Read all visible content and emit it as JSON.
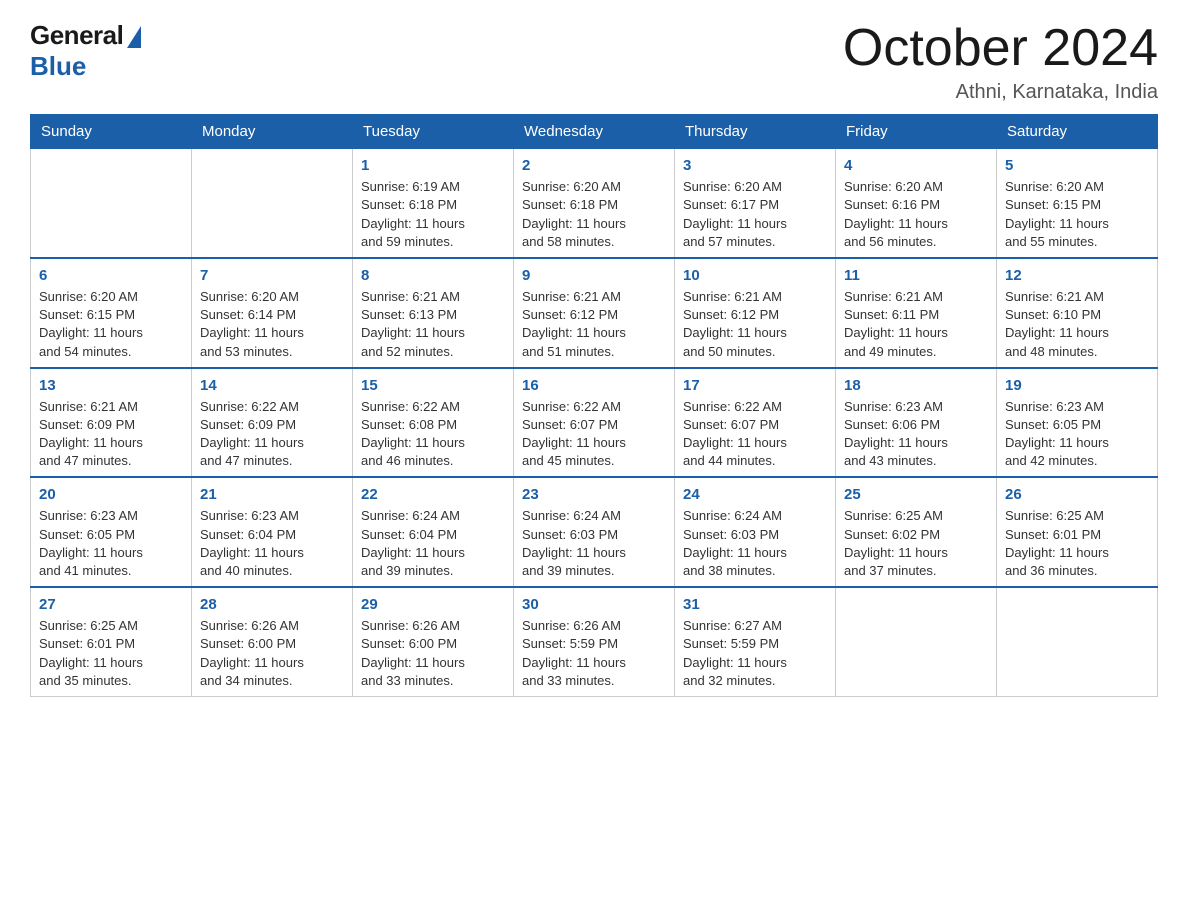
{
  "logo": {
    "general": "General",
    "blue": "Blue"
  },
  "title": "October 2024",
  "location": "Athni, Karnataka, India",
  "headers": [
    "Sunday",
    "Monday",
    "Tuesday",
    "Wednesday",
    "Thursday",
    "Friday",
    "Saturday"
  ],
  "weeks": [
    [
      {
        "day": "",
        "info": ""
      },
      {
        "day": "",
        "info": ""
      },
      {
        "day": "1",
        "info": "Sunrise: 6:19 AM\nSunset: 6:18 PM\nDaylight: 11 hours\nand 59 minutes."
      },
      {
        "day": "2",
        "info": "Sunrise: 6:20 AM\nSunset: 6:18 PM\nDaylight: 11 hours\nand 58 minutes."
      },
      {
        "day": "3",
        "info": "Sunrise: 6:20 AM\nSunset: 6:17 PM\nDaylight: 11 hours\nand 57 minutes."
      },
      {
        "day": "4",
        "info": "Sunrise: 6:20 AM\nSunset: 6:16 PM\nDaylight: 11 hours\nand 56 minutes."
      },
      {
        "day": "5",
        "info": "Sunrise: 6:20 AM\nSunset: 6:15 PM\nDaylight: 11 hours\nand 55 minutes."
      }
    ],
    [
      {
        "day": "6",
        "info": "Sunrise: 6:20 AM\nSunset: 6:15 PM\nDaylight: 11 hours\nand 54 minutes."
      },
      {
        "day": "7",
        "info": "Sunrise: 6:20 AM\nSunset: 6:14 PM\nDaylight: 11 hours\nand 53 minutes."
      },
      {
        "day": "8",
        "info": "Sunrise: 6:21 AM\nSunset: 6:13 PM\nDaylight: 11 hours\nand 52 minutes."
      },
      {
        "day": "9",
        "info": "Sunrise: 6:21 AM\nSunset: 6:12 PM\nDaylight: 11 hours\nand 51 minutes."
      },
      {
        "day": "10",
        "info": "Sunrise: 6:21 AM\nSunset: 6:12 PM\nDaylight: 11 hours\nand 50 minutes."
      },
      {
        "day": "11",
        "info": "Sunrise: 6:21 AM\nSunset: 6:11 PM\nDaylight: 11 hours\nand 49 minutes."
      },
      {
        "day": "12",
        "info": "Sunrise: 6:21 AM\nSunset: 6:10 PM\nDaylight: 11 hours\nand 48 minutes."
      }
    ],
    [
      {
        "day": "13",
        "info": "Sunrise: 6:21 AM\nSunset: 6:09 PM\nDaylight: 11 hours\nand 47 minutes."
      },
      {
        "day": "14",
        "info": "Sunrise: 6:22 AM\nSunset: 6:09 PM\nDaylight: 11 hours\nand 47 minutes."
      },
      {
        "day": "15",
        "info": "Sunrise: 6:22 AM\nSunset: 6:08 PM\nDaylight: 11 hours\nand 46 minutes."
      },
      {
        "day": "16",
        "info": "Sunrise: 6:22 AM\nSunset: 6:07 PM\nDaylight: 11 hours\nand 45 minutes."
      },
      {
        "day": "17",
        "info": "Sunrise: 6:22 AM\nSunset: 6:07 PM\nDaylight: 11 hours\nand 44 minutes."
      },
      {
        "day": "18",
        "info": "Sunrise: 6:23 AM\nSunset: 6:06 PM\nDaylight: 11 hours\nand 43 minutes."
      },
      {
        "day": "19",
        "info": "Sunrise: 6:23 AM\nSunset: 6:05 PM\nDaylight: 11 hours\nand 42 minutes."
      }
    ],
    [
      {
        "day": "20",
        "info": "Sunrise: 6:23 AM\nSunset: 6:05 PM\nDaylight: 11 hours\nand 41 minutes."
      },
      {
        "day": "21",
        "info": "Sunrise: 6:23 AM\nSunset: 6:04 PM\nDaylight: 11 hours\nand 40 minutes."
      },
      {
        "day": "22",
        "info": "Sunrise: 6:24 AM\nSunset: 6:04 PM\nDaylight: 11 hours\nand 39 minutes."
      },
      {
        "day": "23",
        "info": "Sunrise: 6:24 AM\nSunset: 6:03 PM\nDaylight: 11 hours\nand 39 minutes."
      },
      {
        "day": "24",
        "info": "Sunrise: 6:24 AM\nSunset: 6:03 PM\nDaylight: 11 hours\nand 38 minutes."
      },
      {
        "day": "25",
        "info": "Sunrise: 6:25 AM\nSunset: 6:02 PM\nDaylight: 11 hours\nand 37 minutes."
      },
      {
        "day": "26",
        "info": "Sunrise: 6:25 AM\nSunset: 6:01 PM\nDaylight: 11 hours\nand 36 minutes."
      }
    ],
    [
      {
        "day": "27",
        "info": "Sunrise: 6:25 AM\nSunset: 6:01 PM\nDaylight: 11 hours\nand 35 minutes."
      },
      {
        "day": "28",
        "info": "Sunrise: 6:26 AM\nSunset: 6:00 PM\nDaylight: 11 hours\nand 34 minutes."
      },
      {
        "day": "29",
        "info": "Sunrise: 6:26 AM\nSunset: 6:00 PM\nDaylight: 11 hours\nand 33 minutes."
      },
      {
        "day": "30",
        "info": "Sunrise: 6:26 AM\nSunset: 5:59 PM\nDaylight: 11 hours\nand 33 minutes."
      },
      {
        "day": "31",
        "info": "Sunrise: 6:27 AM\nSunset: 5:59 PM\nDaylight: 11 hours\nand 32 minutes."
      },
      {
        "day": "",
        "info": ""
      },
      {
        "day": "",
        "info": ""
      }
    ]
  ]
}
